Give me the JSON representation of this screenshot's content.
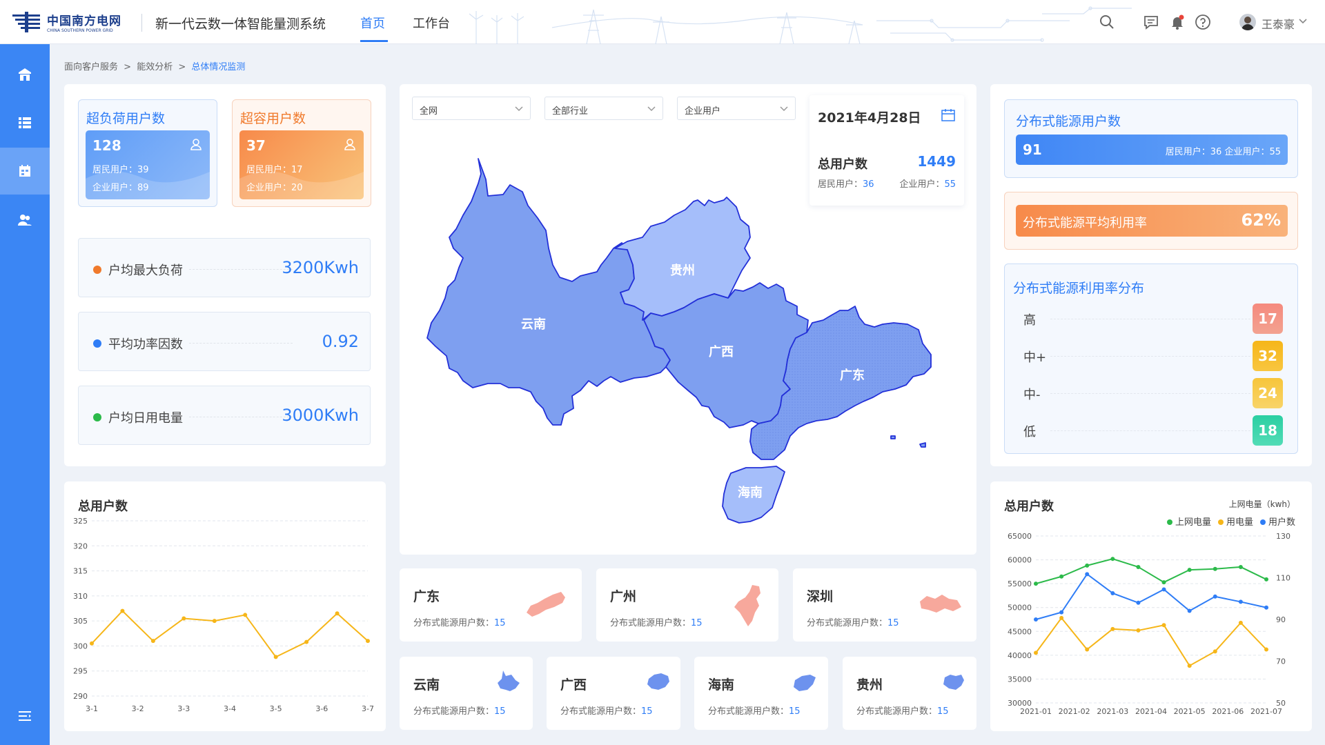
{
  "header": {
    "logo_cn": "中国南方电网",
    "logo_en": "CHINA SOUTHERN POWER GRID",
    "system_title": "新一代云数一体智能量测系统",
    "tabs": [
      {
        "label": "首页",
        "active": true
      },
      {
        "label": "工作台",
        "active": false
      }
    ],
    "user_name": "王泰豪",
    "accent_color": "#2f7df6"
  },
  "sidebar": {
    "items": [
      {
        "icon": "home-icon",
        "active": false
      },
      {
        "icon": "list-icon",
        "active": false
      },
      {
        "icon": "calendar-store-icon",
        "active": true
      },
      {
        "icon": "users-icon",
        "active": false
      }
    ],
    "collapse_icon": "menu-collapse-icon"
  },
  "breadcrumb": {
    "items": [
      "面向客户服务",
      "能效分析"
    ],
    "sep": ">",
    "current": "总体情况监测"
  },
  "overload": {
    "title": "超负荷用户数",
    "count": "128",
    "resident": "居民用户：39",
    "enterprise": "企业用户：89"
  },
  "overcap": {
    "title": "超容用户数",
    "count": "37",
    "resident": "居民用户：17",
    "enterprise": "企业用户：20"
  },
  "stats": [
    {
      "label": "户均最大负荷",
      "value": "3200Kwh",
      "color": "#f07a2c"
    },
    {
      "label": "平均功率因数",
      "value": "0.92",
      "color": "#2f7df6"
    },
    {
      "label": "户均日用电量",
      "value": "3000Kwh",
      "color": "#2cba4a"
    }
  ],
  "filters": {
    "region": "全网",
    "industry": "全部行业",
    "user_type": "企业用户"
  },
  "info_box": {
    "date": "2021年4月28日",
    "total_label": "总用户数",
    "total_value": "1449",
    "resident_label": "居民用户：",
    "resident_value": "36",
    "enterprise_label": "企业用户：",
    "enterprise_value": "55"
  },
  "map": {
    "provinces": [
      "云南",
      "贵州",
      "广西",
      "广东",
      "海南"
    ]
  },
  "distributed": {
    "title": "分布式能源用户数",
    "count": "91",
    "detail": "居民用户：36 企业用户：55",
    "util_label": "分布式能源平均利用率",
    "util_value": "62%",
    "dist_title": "分布式能源利用率分布",
    "levels": [
      {
        "label": "高",
        "value": "17",
        "color": "#f0736a"
      },
      {
        "label": "中+",
        "value": "32",
        "color": "#f6b619"
      },
      {
        "label": "中-",
        "value": "24",
        "color": "#f7c53a"
      },
      {
        "label": "低",
        "value": "18",
        "color": "#2bcfa2"
      }
    ]
  },
  "region_cards": {
    "sub_label": "分布式能源用户数：",
    "row1": [
      {
        "name": "广东",
        "value": "15",
        "icon": "guangdong-shape-icon"
      },
      {
        "name": "广州",
        "value": "15",
        "icon": "guangzhou-shape-icon"
      },
      {
        "name": "深圳",
        "value": "15",
        "icon": "shenzhen-shape-icon"
      }
    ],
    "row2": [
      {
        "name": "云南",
        "value": "15",
        "icon": "yunnan-shape-icon"
      },
      {
        "name": "广西",
        "value": "15",
        "icon": "guangxi-shape-icon"
      },
      {
        "name": "海南",
        "value": "15",
        "icon": "hainan-shape-icon"
      },
      {
        "name": "贵州",
        "value": "15",
        "icon": "guizhou-shape-icon"
      }
    ]
  },
  "chart_data": [
    {
      "type": "line",
      "title": "总用户数",
      "categories": [
        "3-1",
        "3-2",
        "3-3",
        "3-4",
        "3-5",
        "3-6",
        "3-7"
      ],
      "y_ticks": [
        "325",
        "320",
        "315",
        "310",
        "305",
        "300",
        "295",
        "290"
      ],
      "ylim": [
        290,
        325
      ],
      "series": [
        {
          "values": [
            300.5,
            307,
            301,
            305.5,
            305,
            306.2,
            297.8,
            300.8,
            306.5,
            301
          ],
          "color": "#f6b619"
        }
      ],
      "grid": true
    },
    {
      "type": "line",
      "title": "总用户数",
      "right_axis_label": "上网电量（kwh）",
      "categories": [
        "2021-01",
        "2021-02",
        "2021-03",
        "2021-04",
        "2021-05",
        "2021-06",
        "2021-07"
      ],
      "y_left_ticks": [
        "65000",
        "60000",
        "55000",
        "50000",
        "45000",
        "40000",
        "35000",
        "30000"
      ],
      "y_right_ticks": [
        "130",
        "110",
        "90",
        "70",
        "50"
      ],
      "ylim_left": [
        30000,
        65000
      ],
      "ylim_right": [
        50,
        130
      ],
      "legend_position": "top-right",
      "series": [
        {
          "name": "上网电量",
          "color": "#2cba4a",
          "values": [
            55000,
            56500,
            58800,
            60200,
            58500,
            55300,
            57900,
            58100,
            58500,
            55900
          ]
        },
        {
          "name": "用电量",
          "color": "#f6b619",
          "values": [
            40500,
            47800,
            41200,
            45500,
            45200,
            46300,
            37800,
            40800,
            46800,
            41200
          ]
        },
        {
          "name": "用户数",
          "color": "#2f7df6",
          "values": [
            47500,
            49000,
            57000,
            53000,
            51000,
            53800,
            49300,
            52300,
            51200,
            50000
          ]
        }
      ],
      "grid": true
    }
  ]
}
